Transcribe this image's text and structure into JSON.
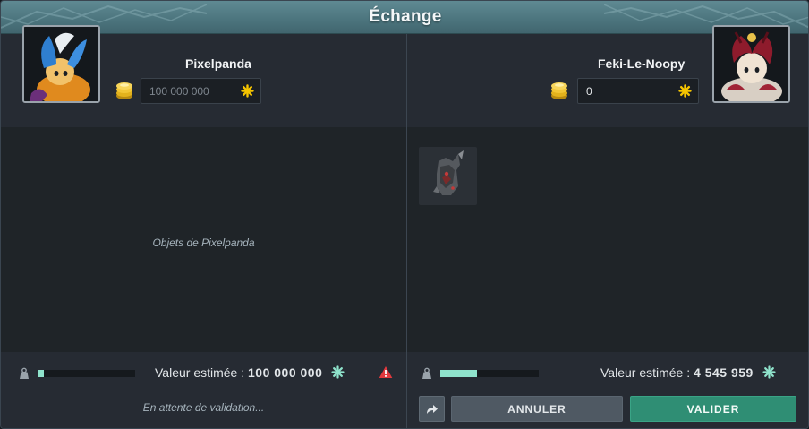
{
  "window": {
    "title": "Échange"
  },
  "left_player": {
    "name": "Pixelpanda",
    "kamas_value": "100 000 000",
    "items_placeholder": "Objets de Pixelpanda",
    "weight_fill": 0.06,
    "estimated_label": "Valeur estimée :",
    "estimated_value": "100 000 000",
    "status": "En attente de validation...",
    "portrait_icon": "character-portrait-icon",
    "warning_icon": "warning-triangle-icon"
  },
  "right_player": {
    "name": "Feki-Le-Noopy",
    "kamas_value": "0",
    "weight_fill": 0.37,
    "estimated_label": "Valeur estimée :",
    "estimated_value": "4 545 959",
    "items": [
      {
        "icon": "armor-item-icon"
      }
    ],
    "portrait_icon": "character-portrait-icon"
  },
  "buttons": {
    "share_icon": "share-arrow-icon",
    "cancel_label": "ANNULER",
    "validate_label": "VALIDER"
  },
  "colors": {
    "title_bar": "#4d767f",
    "validate": "#2f8e74",
    "cancel": "#4f5963",
    "kamas_accent": "#f5c400",
    "weight_fill": "#8fe3cc",
    "warning": "#e0393e"
  }
}
